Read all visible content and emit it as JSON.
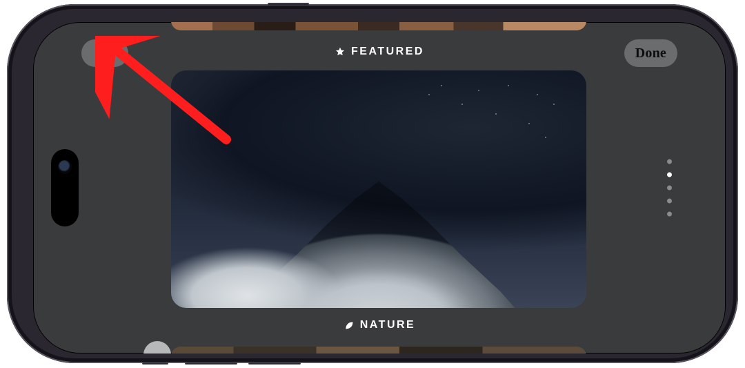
{
  "colors": {
    "accent_red": "#ff1e1e"
  },
  "header": {
    "add_glyph": "+",
    "done_label": "Done"
  },
  "categories": {
    "top": "FEATURED",
    "bottom": "NATURE"
  },
  "pager": {
    "count": 5,
    "active_index": 1
  }
}
